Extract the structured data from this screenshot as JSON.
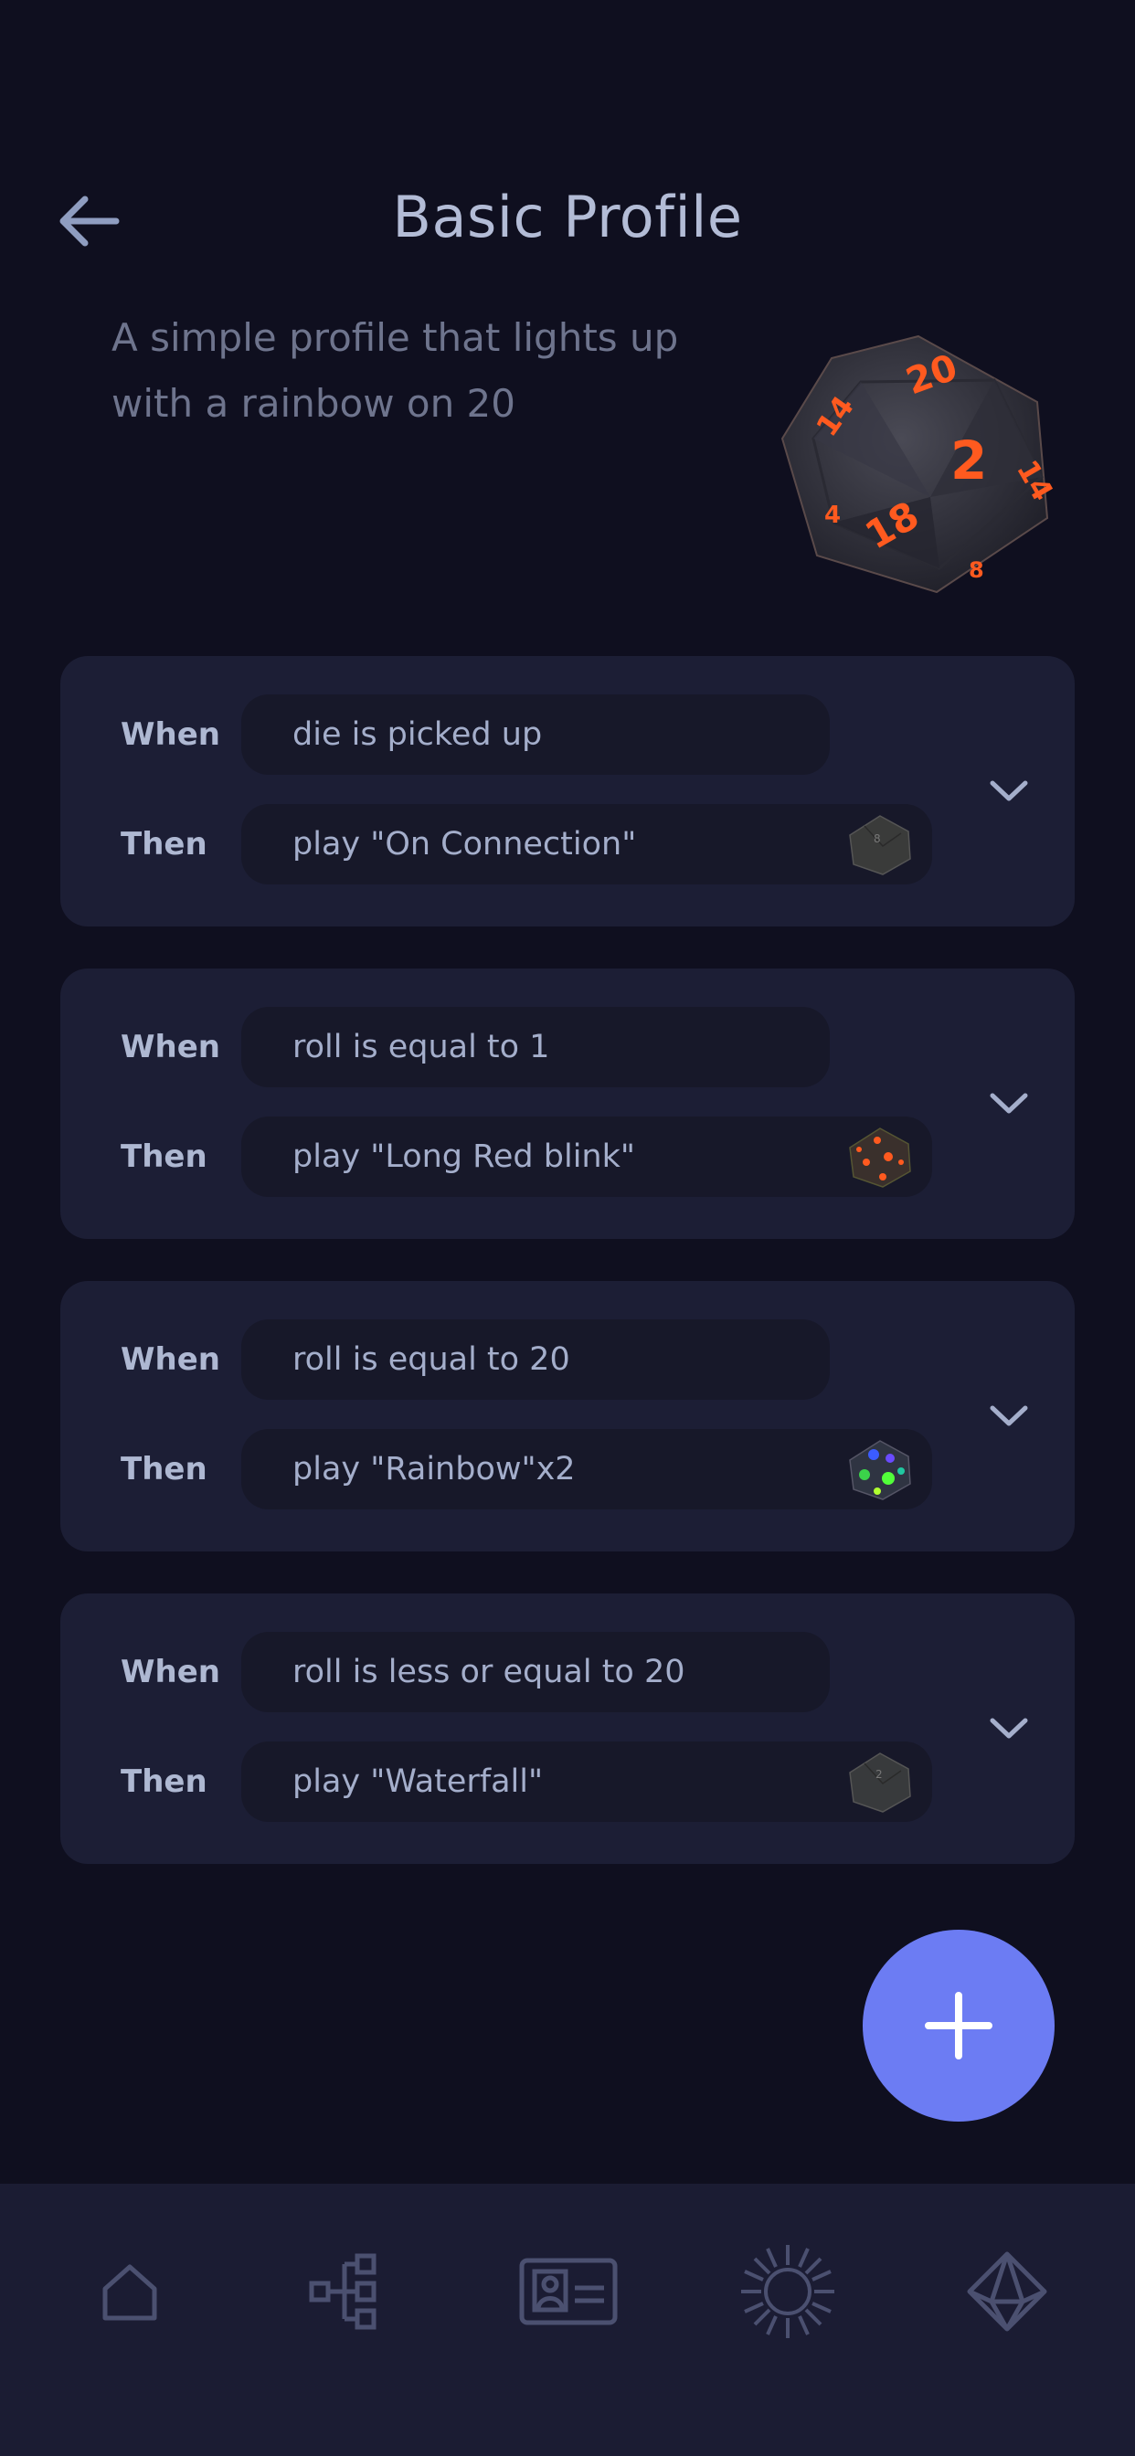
{
  "header": {
    "title": "Basic Profile",
    "back_icon": "arrow-left-icon"
  },
  "profile": {
    "description": "A simple profile that lights up with a rainbow on 20",
    "image": "d20-die-red-glow"
  },
  "rules": [
    {
      "when_label": "When",
      "when": "die is picked up",
      "then_label": "Then",
      "then": "play \"On Connection\"",
      "animation_preview": "dark"
    },
    {
      "when_label": "When",
      "when": "roll is equal to 1",
      "then_label": "Then",
      "then": "play \"Long Red blink\"",
      "animation_preview": "red"
    },
    {
      "when_label": "When",
      "when": "roll is equal to 20",
      "then_label": "Then",
      "then": "play \"Rainbow\"x2",
      "animation_preview": "rainbow"
    },
    {
      "when_label": "When",
      "when": "roll is less or equal to 20",
      "then_label": "Then",
      "then": "play \"Waterfall\"",
      "animation_preview": "dark"
    }
  ],
  "fab": {
    "icon": "plus-icon"
  },
  "bottom_nav": [
    {
      "icon": "home-icon"
    },
    {
      "icon": "hierarchy-icon"
    },
    {
      "icon": "profile-card-icon"
    },
    {
      "icon": "sun-burst-icon"
    },
    {
      "icon": "die-outline-icon"
    }
  ],
  "colors": {
    "background": "#0f0f1f",
    "card": "#1c1e35",
    "accent": "#6c7cf3",
    "text": "#b3bcd6"
  }
}
